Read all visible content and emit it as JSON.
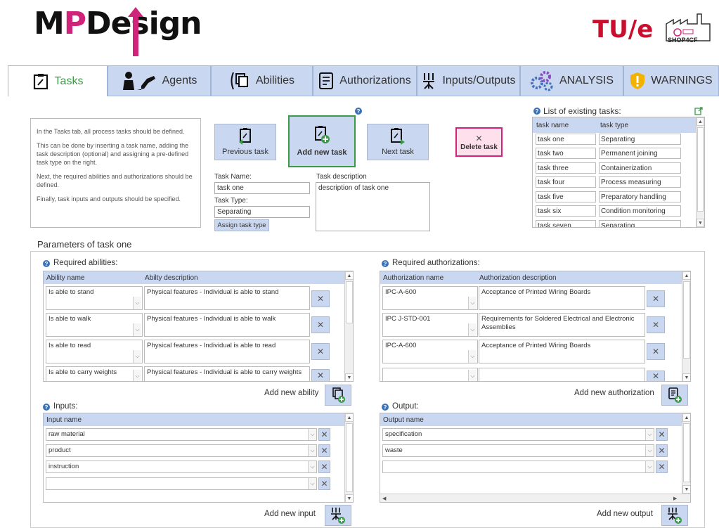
{
  "header": {
    "logo_text_1": "M",
    "logo_text_p": "P",
    "logo_text_2": "Desi",
    "logo_text_3": "gn",
    "tue_logo": "TU/e",
    "shop_logo": "SHOP4CF"
  },
  "tabs": [
    {
      "label": "Tasks",
      "icon": "clipboard-edit-icon",
      "active": true
    },
    {
      "label": "Agents",
      "icon": "worker-robot-icon",
      "active": false
    },
    {
      "label": "Abilities",
      "icon": "abilities-icon",
      "active": false
    },
    {
      "label": "Authorizations",
      "icon": "document-icon",
      "active": false
    },
    {
      "label": "Inputs/Outputs",
      "icon": "io-icon",
      "active": false
    },
    {
      "label": "ANALYSIS",
      "icon": "gears-icon",
      "active": false
    },
    {
      "label": "WARNINGS",
      "icon": "warning-shield-icon",
      "active": false
    }
  ],
  "info": {
    "p1": "In the Tasks tab, all process tasks should be defined.",
    "p2": "This can be done by inserting a task name, adding the task description (optional) and assigning a pre-defined task type on the right.",
    "p3": "Next, the required abilities and authorizations should be defined.",
    "p4": "Finally, task inputs and outputs should be specified."
  },
  "buttons": {
    "prev": "Previous task",
    "add": "Add new task",
    "next": "Next task",
    "delete": "Delete task",
    "assign": "Assign task type"
  },
  "form": {
    "name_label": "Task Name:",
    "name_value": "task one",
    "type_label": "Task Type:",
    "type_value": "Separating",
    "desc_label": "Task description",
    "desc_value": "description of task one"
  },
  "task_list": {
    "title": "List of existing tasks:",
    "col_name": "task name",
    "col_type": "task type",
    "rows": [
      {
        "name": "task one",
        "type": "Separating"
      },
      {
        "name": "task two",
        "type": "Permanent joining"
      },
      {
        "name": "task three",
        "type": "Containerization"
      },
      {
        "name": "task four",
        "type": "Process measuring"
      },
      {
        "name": "task five",
        "type": "Preparatory handling"
      },
      {
        "name": "task six",
        "type": "Condition monitoring"
      },
      {
        "name": "task seven",
        "type": "Separating"
      }
    ]
  },
  "params": {
    "title": "Parameters of task one",
    "abilities": {
      "title": "Required abilities:",
      "col1": "Ability name",
      "col2": "Abilty description",
      "rows": [
        {
          "name": "Is able to stand",
          "desc": "Physical features - Individual is able to stand"
        },
        {
          "name": "Is able to walk",
          "desc": "Physical features - Individual is able to walk"
        },
        {
          "name": "Is able to read",
          "desc": "Physical features - Individual is able to read"
        },
        {
          "name": "Is able to carry weights",
          "desc": "Physical features - Individual is able to carry weights"
        }
      ],
      "add_label": "Add new ability"
    },
    "authorizations": {
      "title": "Required authorizations:",
      "col1": "Authorization name",
      "col2": "Authorization description",
      "rows": [
        {
          "name": "IPC-A-600",
          "desc": "Acceptance of Printed Wiring Boards"
        },
        {
          "name": "IPC J-STD-001",
          "desc": "Requirements for Soldered Electrical and Electronic Assemblies"
        },
        {
          "name": "IPC-A-600",
          "desc": "Acceptance of Printed Wiring Boards"
        },
        {
          "name": "",
          "desc": ""
        }
      ],
      "add_label": "Add new authorization"
    },
    "inputs": {
      "title": "Inputs:",
      "col": "Input name",
      "rows": [
        "raw material",
        "product",
        "instruction",
        ""
      ],
      "add_label": "Add new input"
    },
    "outputs": {
      "title": "Output:",
      "col": "Output name",
      "rows": [
        "specification",
        "waste",
        ""
      ],
      "add_label": "Add new output"
    }
  },
  "colors": {
    "tab_bg": "#c9d7f0",
    "accent_green": "#3a9a48",
    "accent_pink": "#d0237a",
    "tue_red": "#c8102e"
  }
}
